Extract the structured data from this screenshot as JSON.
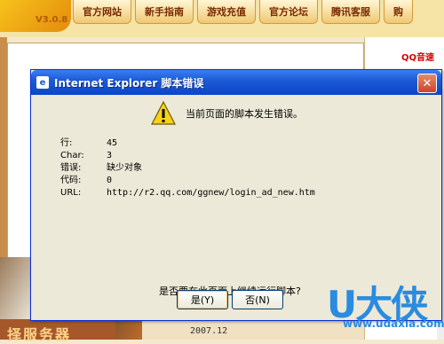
{
  "background": {
    "version": "V3.0.8",
    "nav": [
      "官方网站",
      "新手指南",
      "游戏充值",
      "官方论坛",
      "腾讯客服",
      "购"
    ],
    "right_panel_title": "QQ音速",
    "bottom_banner": "择服务器",
    "bottom_date": "2007.12"
  },
  "dialog": {
    "title": "Internet Explorer 脚本错误",
    "close": "✕",
    "message": "当前页面的脚本发生错误。",
    "details": [
      {
        "label": "行:",
        "value": "45"
      },
      {
        "label": "Char:",
        "value": "3"
      },
      {
        "label": "错误:",
        "value": "缺少对象"
      },
      {
        "label": "代码:",
        "value": "0"
      },
      {
        "label": "URL:",
        "value": "http://r2.qq.com/ggnew/login_ad_new.htm"
      }
    ],
    "question": "是否要在此页面上继续运行脚本?",
    "yes_button": "是(Y)",
    "no_button": "否(N)"
  },
  "watermark": {
    "brand": "U大侠",
    "url": "www.udaxia.com"
  },
  "icons": {
    "warning": "warning-icon",
    "ie": "ie-icon",
    "close": "close-icon"
  },
  "colors": {
    "titlebar": "#0a46c9",
    "dialog_bg": "#ece9d8",
    "watermark": "#2a8be0"
  }
}
